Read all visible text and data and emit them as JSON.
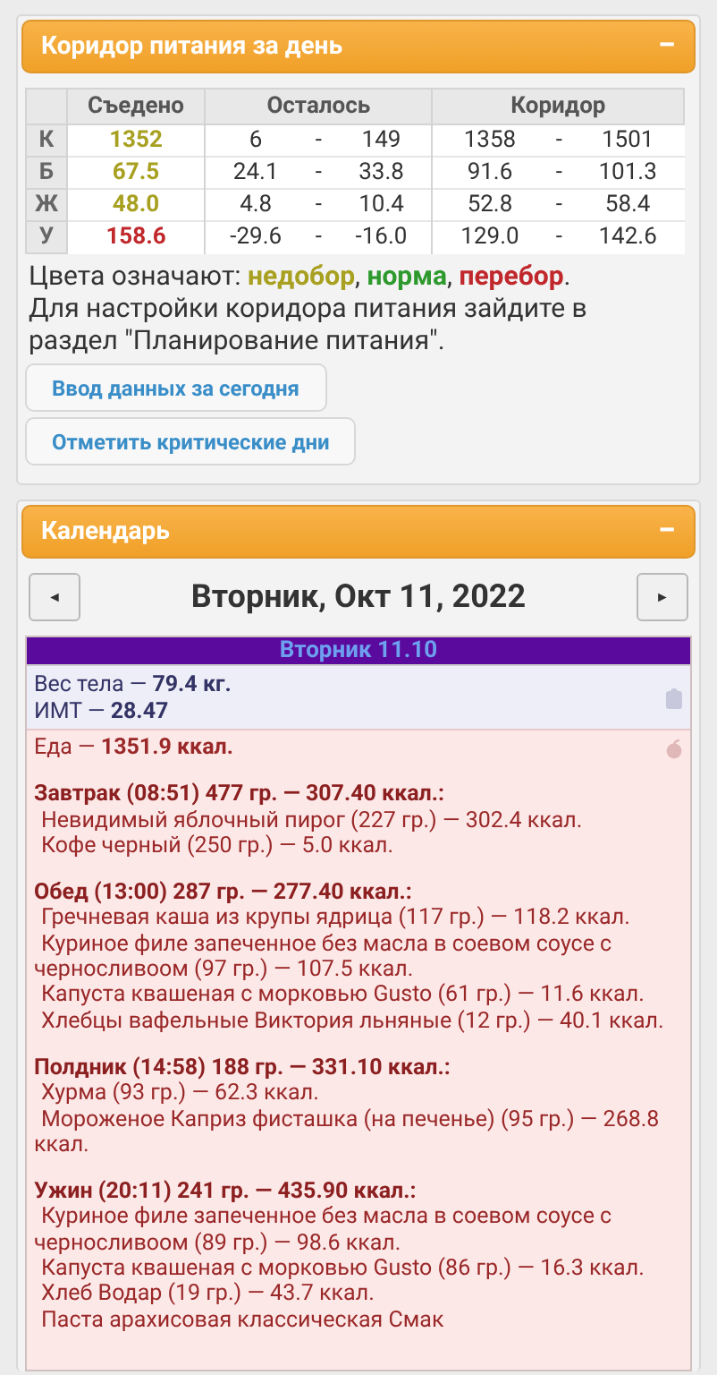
{
  "corridor_panel": {
    "title": "Коридор питания за день",
    "collapse": "−",
    "columns": [
      "Съедено",
      "Осталось",
      "Коридор"
    ],
    "dash": "-",
    "rows": [
      {
        "label": "К",
        "eaten": "1352",
        "color": "#a8a020",
        "left_from": "6",
        "left_to": "149",
        "range_from": "1358",
        "range_to": "1501"
      },
      {
        "label": "Б",
        "eaten": "67.5",
        "color": "#a8a020",
        "left_from": "24.1",
        "left_to": "33.8",
        "range_from": "91.6",
        "range_to": "101.3"
      },
      {
        "label": "Ж",
        "eaten": "48.0",
        "color": "#a8a020",
        "left_from": "4.8",
        "left_to": "10.4",
        "range_from": "52.8",
        "range_to": "58.4"
      },
      {
        "label": "У",
        "eaten": "158.6",
        "color": "#c0282c",
        "left_from": "-29.6",
        "left_to": "-16.0",
        "range_from": "129.0",
        "range_to": "142.6"
      }
    ],
    "legend_label": "Цвета означают:",
    "legend": [
      {
        "text": "недобор",
        "color": "#a8a020"
      },
      {
        "text": "норма",
        "color": "#2e9a2e"
      },
      {
        "text": "перебор",
        "color": "#c0282c"
      }
    ],
    "legend_separator": ",",
    "legend_end": ".",
    "note": "Для настройки коридора питания зайдите в раздел \"Планирование питания\".",
    "buttons": [
      "Ввод данных за сегодня",
      "Отметить критические дни"
    ]
  },
  "calendar_panel": {
    "title": "Календарь",
    "collapse": "−",
    "prev": "◄",
    "next": "►",
    "date": "Вторник, Окт 11, 2022",
    "day": {
      "header": "Вторник 11.10",
      "weight": "Вес тела — **79.4 кг.**",
      "bmi": "ИМТ — **28.47**",
      "food_total": "Еда — **1351.9 ккал.**",
      "meals": [
        {
          "title": "Завтрак (08:51) 477 гр. — 307.40 ккал.:",
          "items": [
            "Невидимый яблочный пирог (227 гр.) — 302.4 ккал.",
            "Кофе черный (250 гр.) — 5.0 ккал."
          ]
        },
        {
          "title": "Обед (13:00) 287 гр. — 277.40 ккал.:",
          "items": [
            "Гречневая каша из крупы ядрица (117 гр.) — 118.2 ккал.",
            "Куриное филе запеченное без масла в соевом соусе с черносливоом (97 гр.) — 107.5 ккал.",
            "Капуста квашеная с морковью Gusto (61 гр.) — 11.6 ккал.",
            "Хлебцы вафельные Виктория льняные (12 гр.) — 40.1 ккал."
          ]
        },
        {
          "title": "Полдник (14:58) 188 гр. — 331.10 ккал.:",
          "items": [
            "Хурма (93 гр.) — 62.3 ккал.",
            "Мороженое Каприз фисташка (на печенье) (95 гр.) — 268.8 ккал."
          ]
        },
        {
          "title": "Ужин (20:11) 241 гр. — 435.90 ккал.:",
          "items": [
            "Куриное филе запеченное без масла в соевом соусе с черносливоом (89 гр.) — 98.6 ккал.",
            "Капуста квашеная с морковью Gusto (86 гр.) — 16.3 ккал.",
            "Хлеб Водар (19 гр.) — 43.7 ккал.",
            "Паста арахисовая классическая Смак"
          ]
        }
      ]
    }
  }
}
